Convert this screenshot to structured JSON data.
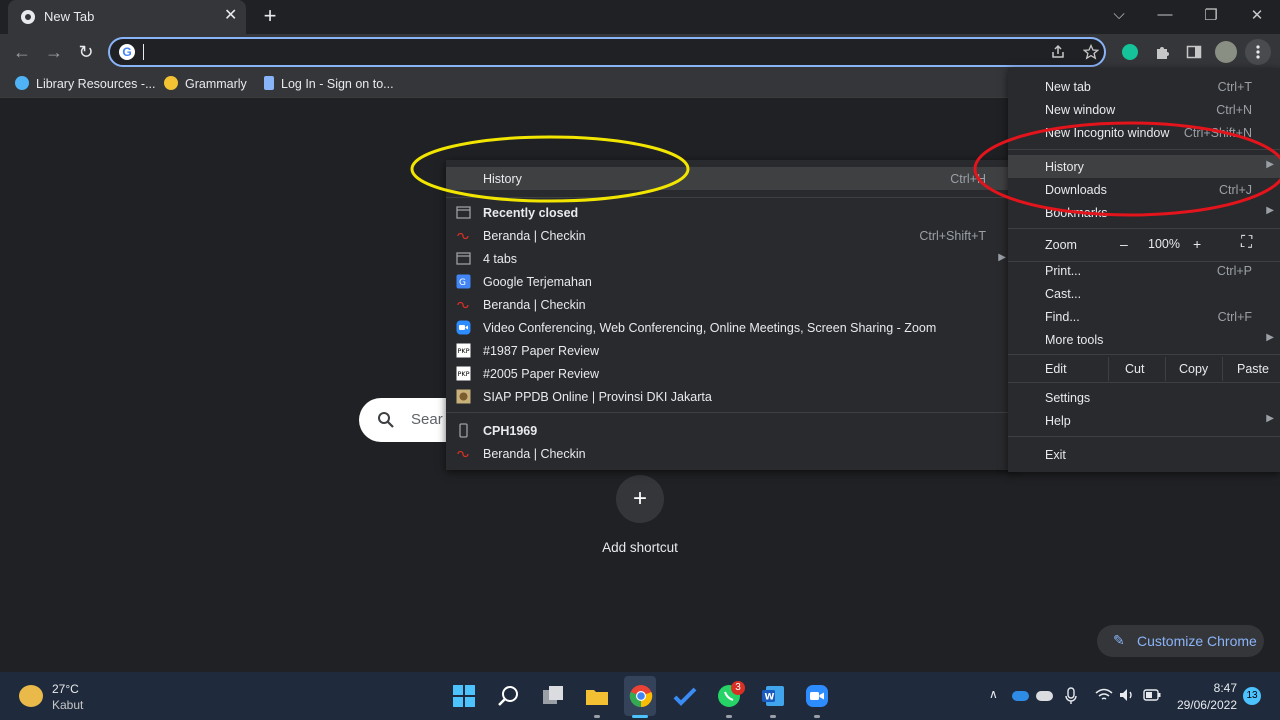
{
  "tab": {
    "title": "New Tab",
    "close": "✕",
    "new_tab": "+"
  },
  "window_controls": {
    "chevron": "⌵",
    "minimize": "—",
    "restore": "❐",
    "close": "✕"
  },
  "toolbar": {
    "back": "←",
    "forward": "→",
    "reload": "↻",
    "omnibox_value": ""
  },
  "bookmarks": [
    {
      "label": "Library Resources -...",
      "icon_color": "#4fb3f5"
    },
    {
      "label": "Grammarly",
      "icon_color": "#15c39a"
    },
    {
      "label": "Log In - Sign on to...",
      "icon_color": "#8ab4f8"
    }
  ],
  "ntp": {
    "search_placeholder": "Sear",
    "add_shortcut_icon": "+",
    "add_shortcut_label": "Add shortcut",
    "customize_label": "Customize Chrome",
    "customize_icon": "✎"
  },
  "chrome_menu": {
    "new_tab": {
      "label": "New tab",
      "shortcut": "Ctrl+T"
    },
    "new_window": {
      "label": "New window",
      "shortcut": "Ctrl+N"
    },
    "incognito": {
      "label": "New Incognito window",
      "shortcut": "Ctrl+Shift+N"
    },
    "history": {
      "label": "History",
      "arrow": "▶"
    },
    "downloads": {
      "label": "Downloads",
      "shortcut": "Ctrl+J"
    },
    "bookmarks": {
      "label": "Bookmarks",
      "arrow": "▶"
    },
    "zoom": {
      "label": "Zoom",
      "minus": "–",
      "value": "100%",
      "plus": "+",
      "fullscreen": "⛶"
    },
    "print": {
      "label": "Print...",
      "shortcut": "Ctrl+P"
    },
    "cast": {
      "label": "Cast..."
    },
    "find": {
      "label": "Find...",
      "shortcut": "Ctrl+F"
    },
    "more_tools": {
      "label": "More tools",
      "arrow": "▶"
    },
    "edit": {
      "label": "Edit",
      "cut": "Cut",
      "copy": "Copy",
      "paste": "Paste"
    },
    "settings": {
      "label": "Settings"
    },
    "help": {
      "label": "Help",
      "arrow": "▶"
    },
    "exit": {
      "label": "Exit"
    }
  },
  "history_menu": {
    "history": {
      "label": "History",
      "shortcut": "Ctrl+H"
    },
    "recently_closed": "Recently closed",
    "items": [
      {
        "label": "Beranda | Checkin",
        "shortcut": "Ctrl+Shift+T",
        "icon": "checkin-icon"
      },
      {
        "label": "4 tabs",
        "arrow": "▶",
        "icon": "window-icon"
      },
      {
        "label": "Google Terjemahan",
        "icon": "translate-icon"
      },
      {
        "label": "Beranda | Checkin",
        "icon": "checkin-icon"
      },
      {
        "label": "Video Conferencing, Web Conferencing, Online Meetings, Screen Sharing - Zoom",
        "icon": "zoom-icon"
      },
      {
        "label": "#1987 Paper Review",
        "icon": "pkp-icon"
      },
      {
        "label": "#2005 Paper Review",
        "icon": "pkp-icon"
      },
      {
        "label": "SIAP PPDB Online | Provinsi DKI Jakarta",
        "icon": "siap-icon"
      }
    ],
    "device": "CPH1969",
    "device_items": [
      {
        "label": "Beranda | Checkin",
        "icon": "checkin-icon"
      }
    ]
  },
  "taskbar": {
    "weather_temp": "27°C",
    "weather_desc": "Kabut",
    "whatsapp_badge": "3",
    "time": "8:47",
    "date": "29/06/2022",
    "notification_count": "13"
  },
  "colors": {
    "yellow_ring": "#f2e600",
    "red_ring": "#e3141b",
    "accent": "#8ab4f8"
  }
}
